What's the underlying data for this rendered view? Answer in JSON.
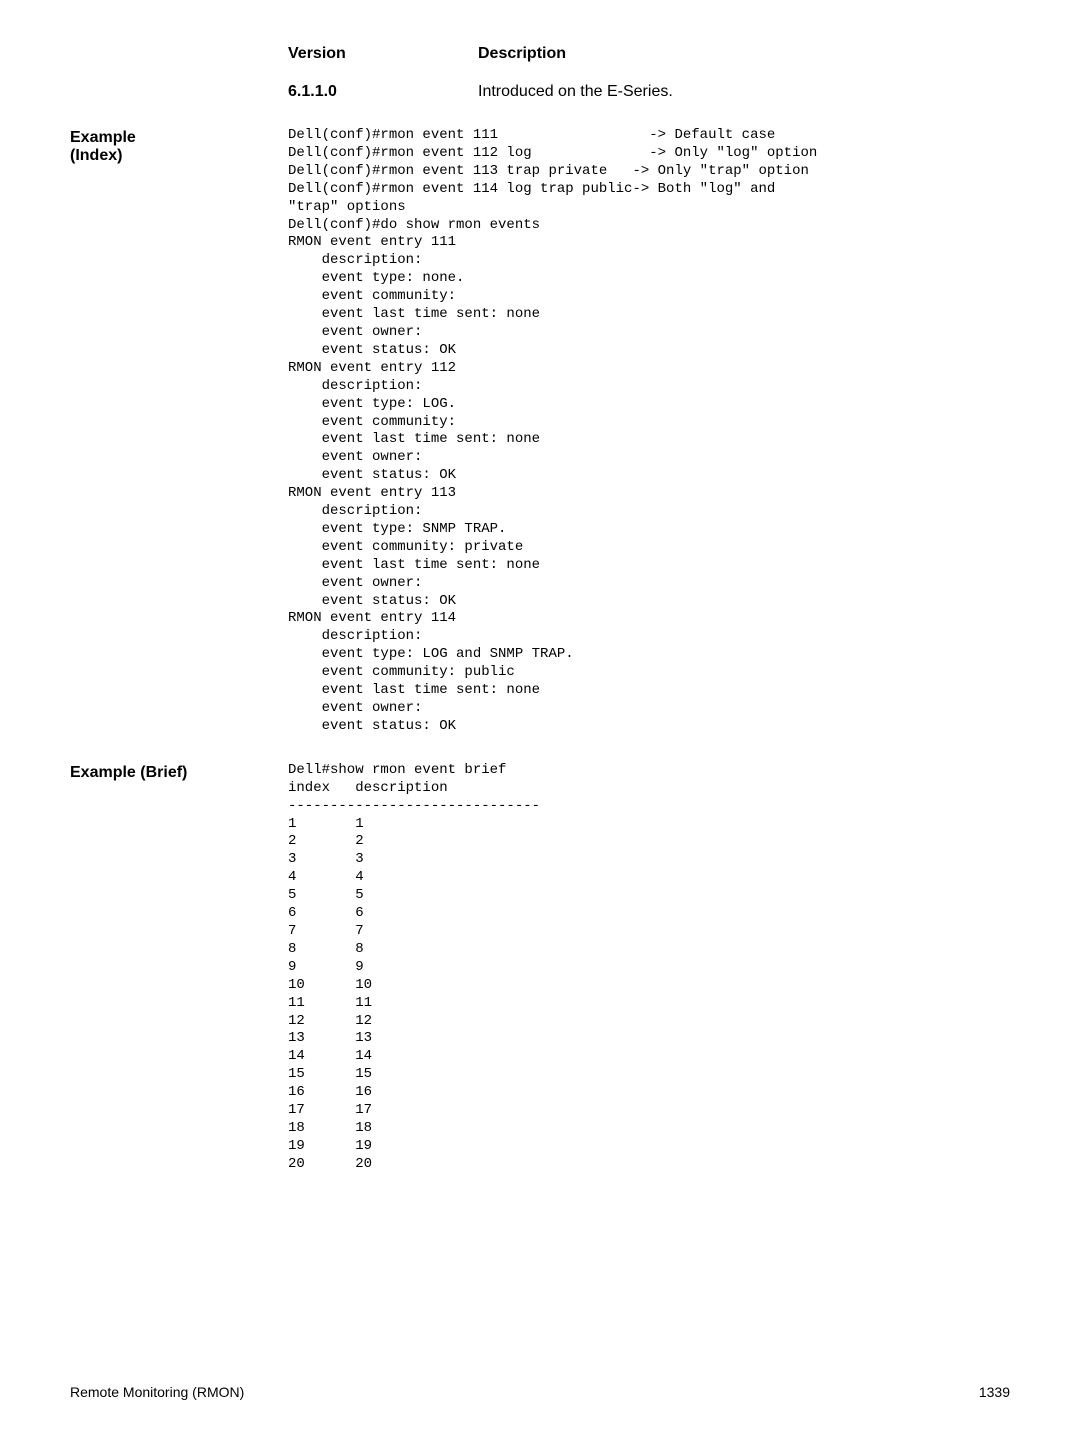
{
  "history_header": {
    "version": "Version",
    "description": "Description"
  },
  "history_row": {
    "version": "6.1.1.0",
    "description": "Introduced on the E-Series."
  },
  "example_index": {
    "label": "Example\n(Index)",
    "code": "Dell(conf)#rmon event 111                  -> Default case\nDell(conf)#rmon event 112 log              -> Only \"log\" option\nDell(conf)#rmon event 113 trap private   -> Only \"trap\" option\nDell(conf)#rmon event 114 log trap public-> Both \"log\" and\n\"trap\" options\nDell(conf)#do show rmon events\nRMON event entry 111\n    description: \n    event type: none.\n    event community: \n    event last time sent: none\n    event owner: \n    event status: OK\nRMON event entry 112\n    description: \n    event type: LOG.\n    event community: \n    event last time sent: none\n    event owner: \n    event status: OK\nRMON event entry 113\n    description: \n    event type: SNMP TRAP.\n    event community: private\n    event last time sent: none\n    event owner: \n    event status: OK\nRMON event entry 114\n    description: \n    event type: LOG and SNMP TRAP.\n    event community: public\n    event last time sent: none\n    event owner: \n    event status: OK"
  },
  "example_brief": {
    "label": "Example (Brief)",
    "code": "Dell#show rmon event brief\nindex   description\n------------------------------\n1       1\n2       2\n3       3\n4       4\n5       5\n6       6\n7       7\n8       8\n9       9\n10      10\n11      11\n12      12\n13      13\n14      14\n15      15\n16      16\n17      17\n18      18\n19      19\n20      20"
  },
  "footer": {
    "left": "Remote Monitoring (RMON)",
    "right": "1339"
  }
}
